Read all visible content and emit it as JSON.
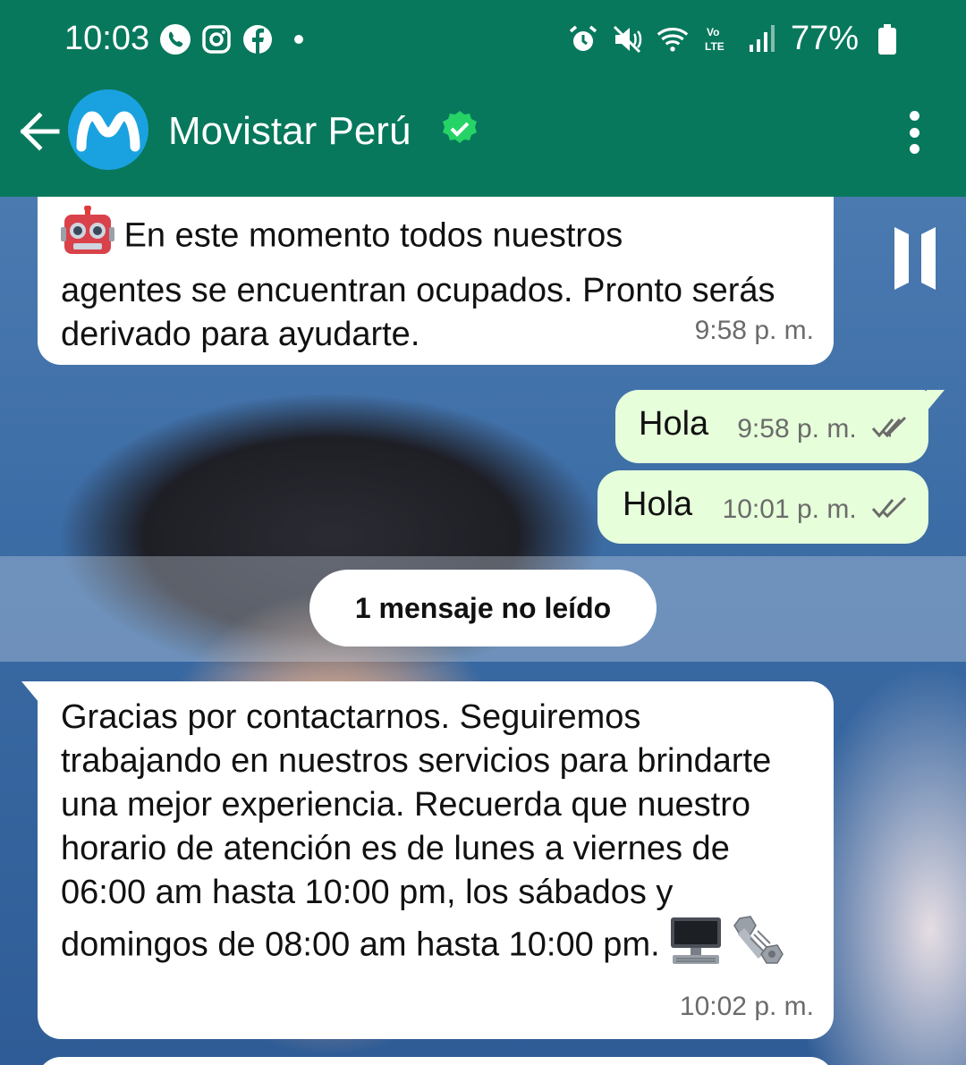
{
  "status_bar": {
    "time": "10:03",
    "battery": "77%",
    "left_icons": [
      "phone-icon",
      "instagram-icon",
      "facebook-icon",
      "dot-icon"
    ],
    "right_icons": [
      "alarm-icon",
      "mute-icon",
      "wifi-icon",
      "volte-icon",
      "signal-icon",
      "battery-icon"
    ]
  },
  "header": {
    "contact_name": "Movistar Perú",
    "avatar_letter": "M",
    "colors": {
      "bar": "#07785c",
      "avatar": "#1aa2e0",
      "verified": "#25d366"
    }
  },
  "messages": [
    {
      "direction": "incoming",
      "emoji": "robot-face-icon",
      "text_line1": "En este momento todos nuestros",
      "text_rest": "agentes se encuentran ocupados. Pronto serás derivado para ayudarte.",
      "time": "9:58 p. m."
    },
    {
      "direction": "outgoing",
      "text": "Hola",
      "time": "9:58 p. m.",
      "status": "read"
    },
    {
      "direction": "outgoing",
      "text": "Hola",
      "time": "10:01 p. m.",
      "status": "read"
    },
    {
      "direction": "incoming",
      "text": "Gracias por contactarnos. Seguiremos trabajando en nuestros servicios para brindarte una mejor experiencia. Recuerda que nuestro horario de atención es de lunes a viernes de 06:00 am hasta 10:00 pm, los sábados y domingos de 08:00 am hasta 10:00 pm.",
      "emojis": [
        "desktop-computer-icon",
        "nut-and-bolt-icon"
      ],
      "time": "10:02 p. m."
    }
  ],
  "unread_divider": "1 mensaje no leído"
}
